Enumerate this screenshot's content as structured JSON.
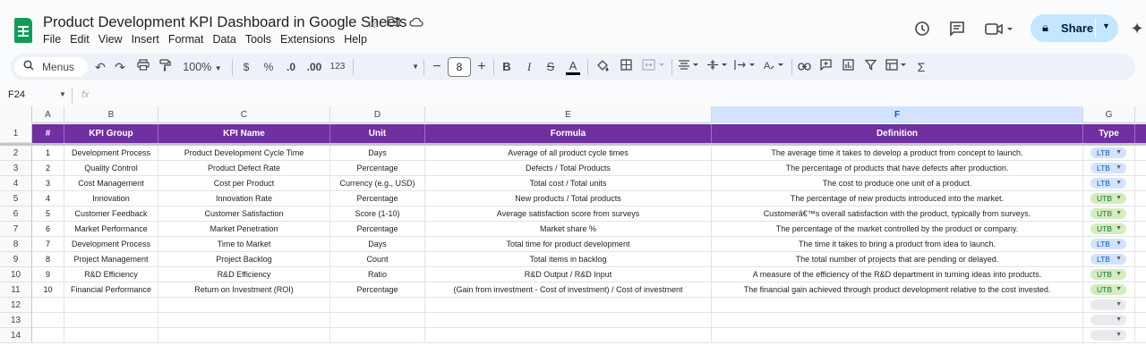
{
  "doc": {
    "title": "Product Development KPI Dashboard in Google Sheets",
    "menu": [
      "File",
      "Edit",
      "View",
      "Insert",
      "Format",
      "Data",
      "Tools",
      "Extensions",
      "Help"
    ],
    "share_label": "Share"
  },
  "toolbar": {
    "search_label": "Menus",
    "zoom": "100%",
    "currency": "$",
    "percent": "%",
    "dec_decrease": ".0",
    "dec_increase": ".00",
    "number_format": "123",
    "font_size": "8"
  },
  "formula_bar": {
    "cell_ref": "F24",
    "fx": "fx"
  },
  "columns": [
    "A",
    "B",
    "C",
    "D",
    "E",
    "F",
    "G"
  ],
  "selected_column": "F",
  "headers": [
    "#",
    "KPI Group",
    "KPI Name",
    "Unit",
    "Formula",
    "Definition",
    "Type"
  ],
  "rows": [
    {
      "num": "1",
      "group": "Development Process",
      "name": "Product Development Cycle Time",
      "unit": "Days",
      "formula": "Average of all product cycle times",
      "definition": "The average time it takes to develop a product from concept to launch.",
      "type": "LTB"
    },
    {
      "num": "2",
      "group": "Quality Control",
      "name": "Product Defect Rate",
      "unit": "Percentage",
      "formula": "Defects / Total Products",
      "definition": "The percentage of products that have defects after production.",
      "type": "LTB"
    },
    {
      "num": "3",
      "group": "Cost Management",
      "name": "Cost per Product",
      "unit": "Currency (e.g., USD)",
      "formula": "Total cost / Total units",
      "definition": "The cost to produce one unit of a product.",
      "type": "LTB"
    },
    {
      "num": "4",
      "group": "Innovation",
      "name": "Innovation Rate",
      "unit": "Percentage",
      "formula": "New products / Total products",
      "definition": "The percentage of new products introduced into the market.",
      "type": "UTB"
    },
    {
      "num": "5",
      "group": "Customer Feedback",
      "name": "Customer Satisfaction",
      "unit": "Score (1-10)",
      "formula": "Average satisfaction score from surveys",
      "definition": "Customerâ€™s overall satisfaction with the product, typically from surveys.",
      "type": "UTB"
    },
    {
      "num": "6",
      "group": "Market Performance",
      "name": "Market Penetration",
      "unit": "Percentage",
      "formula": "Market share %",
      "definition": "The percentage of the market controlled by the product or company.",
      "type": "UTB"
    },
    {
      "num": "7",
      "group": "Development Process",
      "name": "Time to Market",
      "unit": "Days",
      "formula": "Total time for product development",
      "definition": "The time it takes to bring a product from idea to launch.",
      "type": "LTB"
    },
    {
      "num": "8",
      "group": "Project Management",
      "name": "Project Backlog",
      "unit": "Count",
      "formula": "Total items in backlog",
      "definition": "The total number of projects that are pending or delayed.",
      "type": "LTB"
    },
    {
      "num": "9",
      "group": "R&D Efficiency",
      "name": "R&D Efficiency",
      "unit": "Ratio",
      "formula": "R&D Output / R&D Input",
      "definition": "A measure of the efficiency of the R&D department in turning ideas into products.",
      "type": "UTB"
    },
    {
      "num": "10",
      "group": "Financial Performance",
      "name": "Return on Investment (ROI)",
      "unit": "Percentage",
      "formula": "(Gain from investment - Cost of investment) / Cost of investment",
      "definition": "The financial gain achieved through product development relative to the cost invested.",
      "type": "UTB"
    }
  ],
  "row_numbers": [
    "1",
    "2",
    "3",
    "4",
    "5",
    "6",
    "7",
    "8",
    "9",
    "10",
    "11",
    "12",
    "13",
    "14"
  ],
  "colors": {
    "header_bg": "#7030a0",
    "ltb_bg": "#d3e3fd",
    "utb_bg": "#d4edbc",
    "share_bg": "#c2e7ff"
  }
}
